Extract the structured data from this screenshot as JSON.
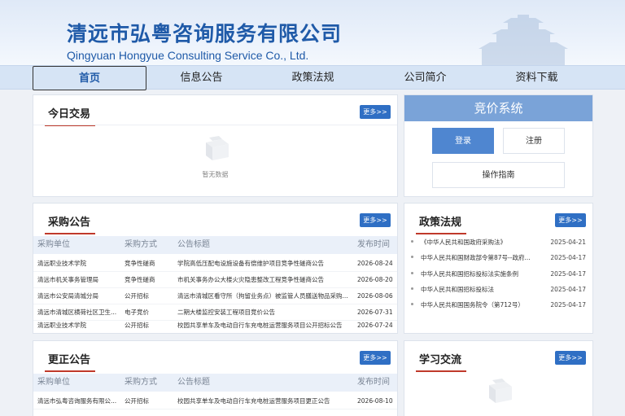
{
  "header": {
    "company_cn": "清远市弘粤咨询服务有限公司",
    "company_en": "Qingyuan Hongyue Consulting Service Co., Ltd."
  },
  "nav": {
    "items": [
      {
        "label": "首页",
        "active": true
      },
      {
        "label": "信息公告",
        "active": false
      },
      {
        "label": "政策法规",
        "active": false
      },
      {
        "label": "公司简介",
        "active": false
      },
      {
        "label": "资料下载",
        "active": false
      }
    ]
  },
  "common": {
    "more_label": "更多>>",
    "empty_label": "暂无数据"
  },
  "today_trade": {
    "title": "今日交易"
  },
  "procurement": {
    "title": "采购公告",
    "columns": [
      "采购单位",
      "采购方式",
      "公告标题",
      "发布时间"
    ],
    "rows": [
      [
        "清远职业技术学院",
        "竞争性磋商",
        "学院高低压配电设施设备有偿维护项目竞争性磋商公告",
        "2026-08-24"
      ],
      [
        "清远市机关事务管理局",
        "竞争性磋商",
        "市机关事务办公大楼火灾隐患整改工程竞争性磋商公告",
        "2026-08-20"
      ],
      [
        "清远市公安局清城分局",
        "公开招标",
        "清远市清城区看守所（拘留业务点）被监管人员膳送物品采购...",
        "2026-08-06"
      ],
      [
        "清远市清城区横荷社区卫生...",
        "电子竞价",
        "二期大楼监控安装工程项目竞价公告",
        "2026-07-31"
      ],
      [
        "清远职业技术学院",
        "公开招标",
        "校园共享单车及电动自行车充电桩运营服务项目公开招标公告",
        "2026-07-24"
      ]
    ]
  },
  "correction": {
    "title": "更正公告",
    "columns": [
      "采购单位",
      "采购方式",
      "公告标题",
      "发布时间"
    ],
    "rows": [
      [
        "清远市弘粤咨询服务有限公...",
        "公开招标",
        "校园共享单车及电动自行车充电桩运营服务项目更正公告",
        "2026-08-10"
      ]
    ]
  },
  "bidding": {
    "title": "竞价系统",
    "login": "登录",
    "register": "注册",
    "guide": "操作指南"
  },
  "policy": {
    "title": "政策法规",
    "items": [
      {
        "title": "《中华人民共和国政府采购法》",
        "date": "2025-04-21"
      },
      {
        "title": "中华人民共和国财政部令第87号--政府...",
        "date": "2025-04-17"
      },
      {
        "title": "中华人民共和国招标投标法实施条例",
        "date": "2025-04-17"
      },
      {
        "title": "中华人民共和国招标投标法",
        "date": "2025-04-17"
      },
      {
        "title": "中华人民共和国国务院令（第712号）",
        "date": "2025-04-17"
      }
    ]
  },
  "study": {
    "title": "学习交流"
  }
}
